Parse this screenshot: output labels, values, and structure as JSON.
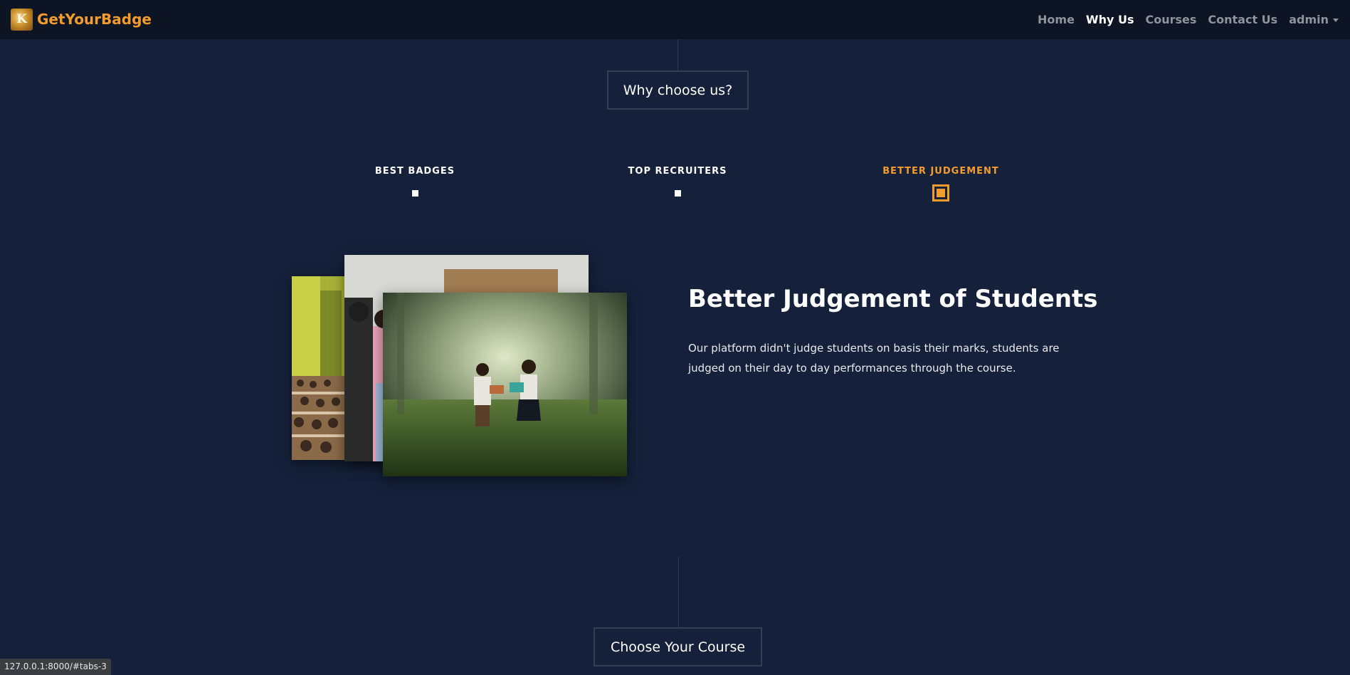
{
  "nav": {
    "brand": "GetYourBadge",
    "logo_letter": "K",
    "links": [
      "Home",
      "Why Us",
      "Courses",
      "Contact Us",
      "admin"
    ],
    "active": "Why Us"
  },
  "why_section": {
    "title": "Why choose us?",
    "tabs": [
      "BEST BADGES",
      "TOP RECRUITERS",
      "BETTER JUDGEMENT"
    ],
    "active_tab": "BETTER JUDGEMENT",
    "content_title": "Better Judgement of Students",
    "content_text": "Our platform didn't judge students on basis their marks, students are judged on their day to day performances through the course."
  },
  "course_section": {
    "title": "Choose Your Course"
  },
  "status_bar": {
    "url": "127.0.0.1:8000/#tabs-3"
  },
  "colors": {
    "background": "#15213a",
    "navbar": "#0d1423",
    "accent": "#f39c2e"
  }
}
